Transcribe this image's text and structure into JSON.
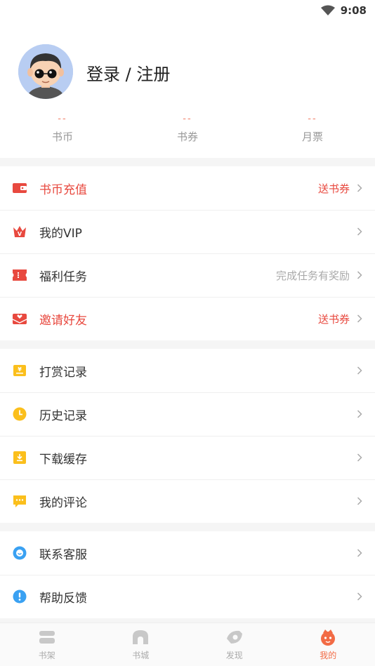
{
  "status_bar": {
    "time": "9:08"
  },
  "profile": {
    "login_label": "登录 / 注册"
  },
  "stats": [
    {
      "value": "--",
      "label": "书币"
    },
    {
      "value": "--",
      "label": "书券"
    },
    {
      "value": "--",
      "label": "月票"
    }
  ],
  "menu": {
    "recharge": {
      "label": "书币充值",
      "hint": "送书券"
    },
    "vip": {
      "label": "我的VIP"
    },
    "tasks": {
      "label": "福利任务",
      "hint": "完成任务有奖励"
    },
    "invite": {
      "label": "邀请好友",
      "hint": "送书券"
    },
    "rewards": {
      "label": "打赏记录"
    },
    "history": {
      "label": "历史记录"
    },
    "downloads": {
      "label": "下载缓存"
    },
    "comments": {
      "label": "我的评论"
    },
    "support": {
      "label": "联系客服"
    },
    "feedback": {
      "label": "帮助反馈"
    }
  },
  "tabbar": [
    {
      "label": "书架"
    },
    {
      "label": "书城"
    },
    {
      "label": "发现"
    },
    {
      "label": "我的",
      "active": true
    }
  ],
  "colors": {
    "accent": "#e8493f",
    "tab_active": "#f26b45",
    "yellow_icon": "#fbbf1c",
    "blue_icon": "#3aa1f2"
  }
}
